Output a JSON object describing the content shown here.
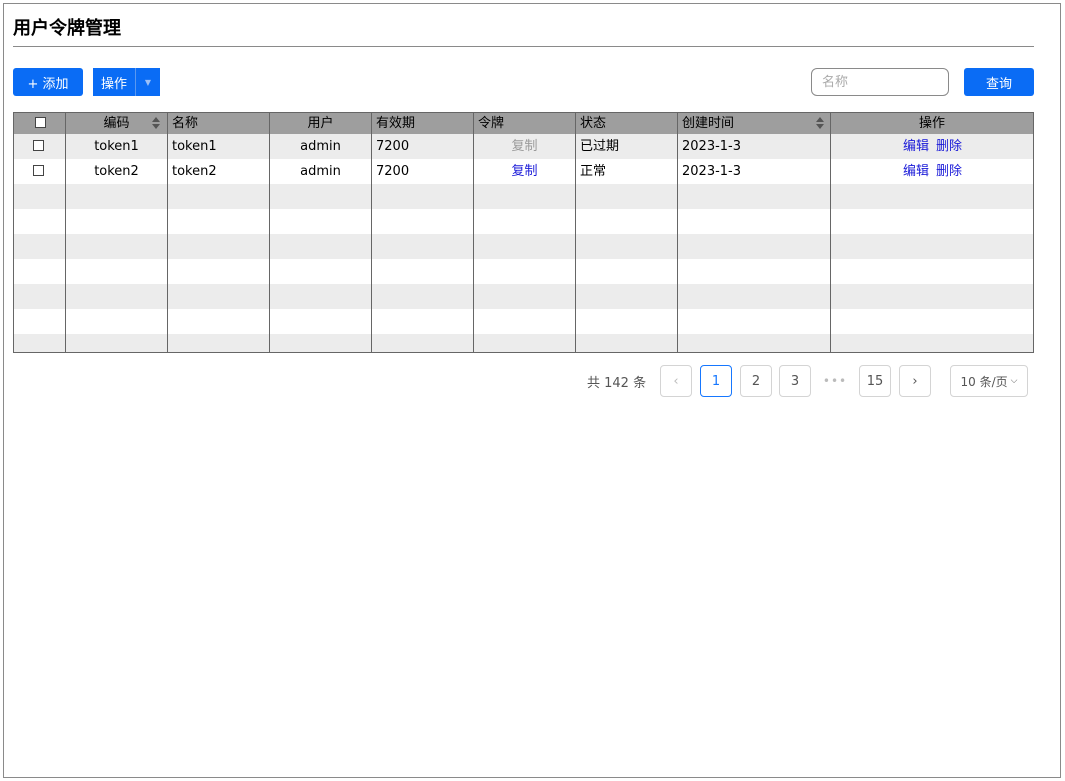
{
  "page": {
    "title": "用户令牌管理"
  },
  "toolbar": {
    "add_label": "+ 添加",
    "ops_label": "操作",
    "search_placeholder": "名称",
    "search_value": "",
    "query_label": "查询"
  },
  "table": {
    "columns": [
      "编码",
      "名称",
      "用户",
      "有效期",
      "令牌",
      "状态",
      "创建时间",
      "操作"
    ],
    "rows": [
      {
        "code": "token1",
        "name": "token1",
        "user": "admin",
        "validity": "7200",
        "token_action": "复制",
        "token_disabled": true,
        "status": "已过期",
        "created": "2023-1-3",
        "edit": "编辑",
        "delete": "删除"
      },
      {
        "code": "token2",
        "name": "token2",
        "user": "admin",
        "validity": "7200",
        "token_action": "复制",
        "token_disabled": false,
        "status": "正常",
        "created": "2023-1-3",
        "edit": "编辑",
        "delete": "删除"
      }
    ]
  },
  "pagination": {
    "total_text": "共 142 条",
    "pages": [
      "1",
      "2",
      "3",
      "15"
    ],
    "current": "1",
    "ellipsis": "•••",
    "page_size": "10 条/页"
  }
}
